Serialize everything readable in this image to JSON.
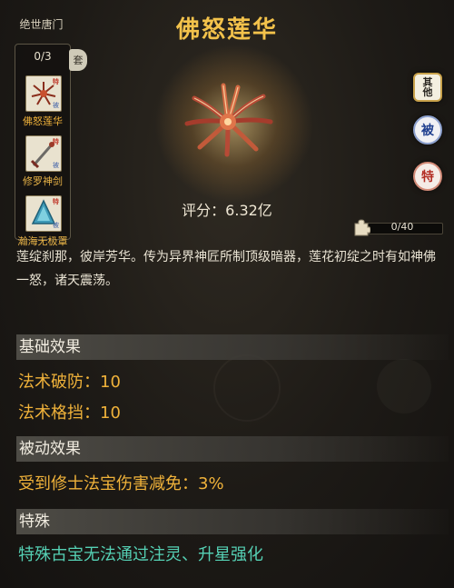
{
  "set": {
    "title": "绝世唐门",
    "count": "0/3",
    "arrow_label": "套",
    "items": [
      {
        "label": "佛怒莲华",
        "tag_top": "特",
        "tag_bottom": "被"
      },
      {
        "label": "修罗神剑",
        "tag_top": "特",
        "tag_bottom": "被"
      },
      {
        "label": "瀚海无极罩",
        "tag_top": "特",
        "tag_bottom": "被"
      }
    ]
  },
  "item": {
    "name": "佛怒莲华",
    "score": "评分：6.32亿",
    "progress": "0/40",
    "progress_value": 0,
    "description": "莲绽刹那，彼岸芳华。传为异界神匠所制顶级暗器，莲花初绽之时有如神佛一怒，诸天震荡。"
  },
  "badges": {
    "other": "其他",
    "passive": "被",
    "special": "特"
  },
  "sections": {
    "basic": {
      "header": "基础效果",
      "attrs": [
        "法术破防：10",
        "法术格挡：10"
      ]
    },
    "passive": {
      "header": "被动效果",
      "attrs": [
        "受到修士法宝伤害减免：3%"
      ]
    },
    "special": {
      "header": "特殊",
      "attrs": [
        "特殊古宝无法通过注灵、升星强化"
      ]
    }
  },
  "colors": {
    "title": "#f3c24b",
    "attr": "#f0b23a",
    "special_attr": "#55d0b4"
  }
}
